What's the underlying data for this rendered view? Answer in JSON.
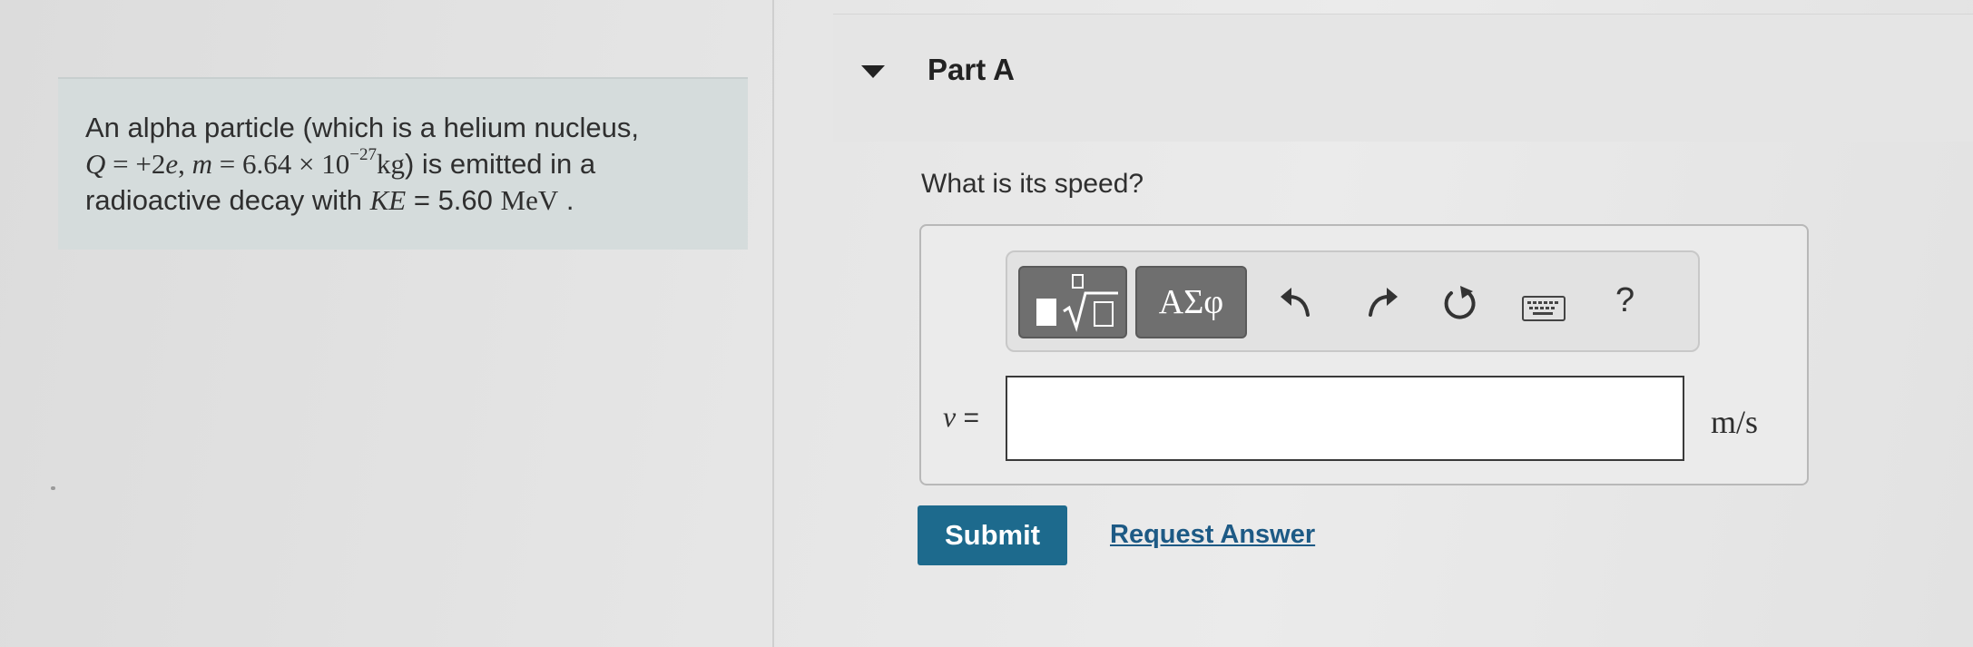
{
  "problem": {
    "line1": "An alpha particle (which is a helium nucleus,",
    "q_sym": "Q",
    "q_eq": " = +2",
    "e_sym": "e",
    "m_sym": "m",
    "m_eq": " = 6.64 × 10",
    "m_exp": "−27",
    "m_unit": "kg",
    "after_m": ") is emitted in a",
    "line3_prefix": "radioactive decay with ",
    "ke_sym": "KE",
    "ke_eq": " = 5.60 ",
    "ke_unit": "MeV",
    "line3_suffix": " ."
  },
  "part": {
    "title": "Part A"
  },
  "question": "What is its speed?",
  "toolbar": {
    "templates_icon": "templates-radical-icon",
    "greek_label": "ΑΣφ",
    "undo_icon": "undo-icon",
    "redo_icon": "redo-icon",
    "reset_icon": "reset-icon",
    "keyboard_icon": "keyboard-icon",
    "help_label": "?"
  },
  "answer": {
    "variable": "v",
    "equals": " =",
    "value": "",
    "units": "m/s"
  },
  "actions": {
    "submit_label": "Submit",
    "request_label": "Request Answer"
  },
  "colors": {
    "submit_bg": "#1d6a8d",
    "link": "#1d5a85",
    "problem_bg": "#d5dcdc",
    "tool_button_bg": "#6f6f6f"
  }
}
